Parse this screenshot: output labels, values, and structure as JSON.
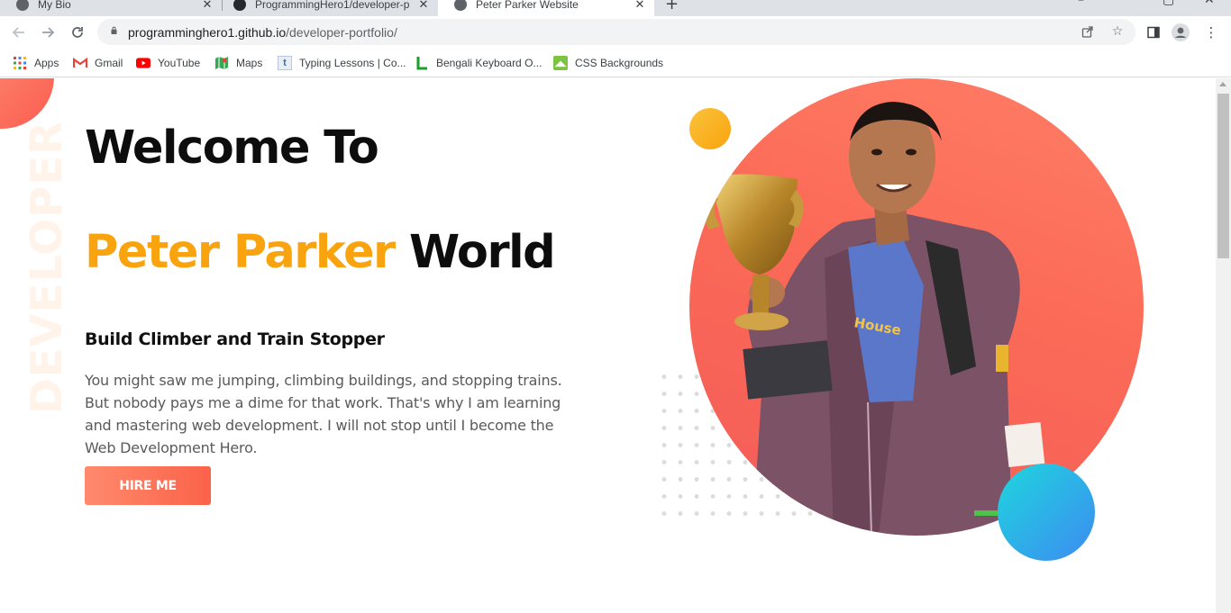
{
  "browser": {
    "tabs": [
      {
        "title": "My Bio"
      },
      {
        "title": "ProgrammingHero1/developer-p"
      },
      {
        "title": "Peter Parker Website"
      }
    ],
    "address": {
      "host": "programminghero1.github.io",
      "path": "/developer-portfolio/"
    },
    "bookmarks": [
      {
        "label": "Apps",
        "icon": "apps-grid-icon"
      },
      {
        "label": "Gmail",
        "icon": "gmail-icon"
      },
      {
        "label": "YouTube",
        "icon": "youtube-icon"
      },
      {
        "label": "Maps",
        "icon": "maps-icon"
      },
      {
        "label": "Typing Lessons | Co...",
        "icon": "typing-icon"
      },
      {
        "label": "Bengali Keyboard O...",
        "icon": "keyboard-icon"
      },
      {
        "label": "CSS Backgrounds",
        "icon": "css-icon"
      }
    ]
  },
  "page": {
    "side_word": "DEVELOPER",
    "heading_line1": "Welcome To",
    "heading_name": "Peter Parker",
    "heading_rest": "World",
    "subtitle": "Build Climber and Train Stopper",
    "description": "You might saw me jumping, climbing buildings, and stopping trains. But nobody pays me a dime for that work. That's why I am learning and mastering web development. I will not stop until I become the Web Development Hero.",
    "hire_label": "HIRE ME",
    "portrait_shirt_text": "House"
  },
  "colors": {
    "accent_name": "#f9a30f",
    "button": "#fb6249",
    "circle": "#fb6a57",
    "blue_blob": "#3d8bf2",
    "yellow_blob": "#f9a30f"
  }
}
